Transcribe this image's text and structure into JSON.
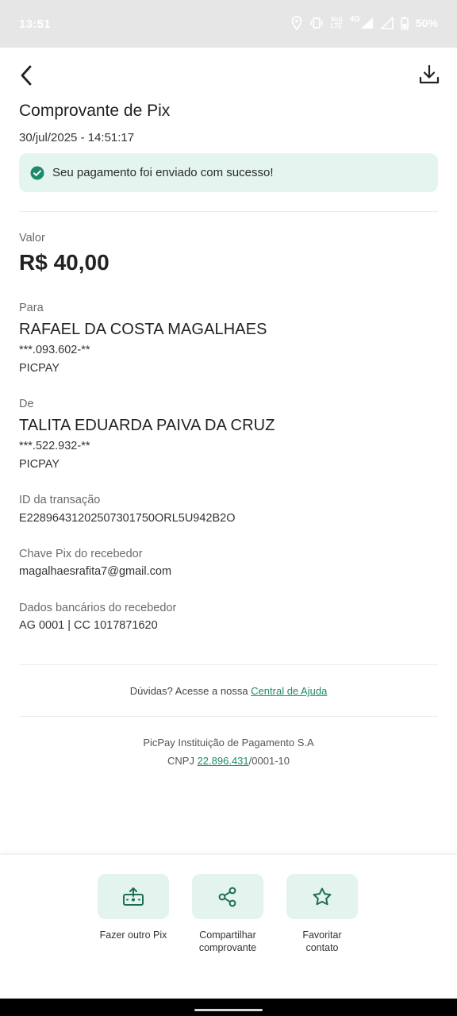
{
  "status_bar": {
    "time": "13:51",
    "net_top": "Vo))",
    "net_bottom": "LTE",
    "network": "4G",
    "battery": "50%"
  },
  "header": {
    "title": "Comprovante de Pix",
    "datetime": "30/jul/2025 - 14:51:17"
  },
  "success": {
    "message": "Seu pagamento foi enviado com sucesso!"
  },
  "amount": {
    "label": "Valor",
    "value": "R$ 40,00"
  },
  "recipient": {
    "label": "Para",
    "name": "RAFAEL DA COSTA MAGALHAES",
    "document": "***.093.602-**",
    "institution": "PICPAY"
  },
  "payer": {
    "label": "De",
    "name": "TALITA EDUARDA PAIVA DA CRUZ",
    "document": "***.522.932-**",
    "institution": "PICPAY"
  },
  "transaction": {
    "label": "ID da transação",
    "value": "E22896431202507301750ORL5U942B2O"
  },
  "pix_key": {
    "label": "Chave Pix do recebedor",
    "value": "magalhaesrafita7@gmail.com"
  },
  "bank": {
    "label": "Dados bancários do recebedor",
    "value": "AG 0001 | CC 1017871620"
  },
  "help": {
    "prefix": "Dúvidas? Acesse a nossa ",
    "link": "Central de Ajuda"
  },
  "footer": {
    "company": "PicPay Instituição de Pagamento S.A",
    "cnpj_prefix": "CNPJ ",
    "cnpj_link": "22.896.431",
    "cnpj_suffix": "/0001-10"
  },
  "actions": [
    {
      "label_line1": "Fazer outro Pix",
      "label_line2": "",
      "icon": "pix-send-icon"
    },
    {
      "label_line1": "Compartilhar",
      "label_line2": "comprovante",
      "icon": "share-icon"
    },
    {
      "label_line1": "Favoritar",
      "label_line2": "contato",
      "icon": "star-icon"
    }
  ],
  "colors": {
    "accent": "#1e8a6c",
    "success_bg": "#e3f5ee",
    "action_bg": "#e3f3ee",
    "status_bar_bg": "#e6e6e6"
  }
}
